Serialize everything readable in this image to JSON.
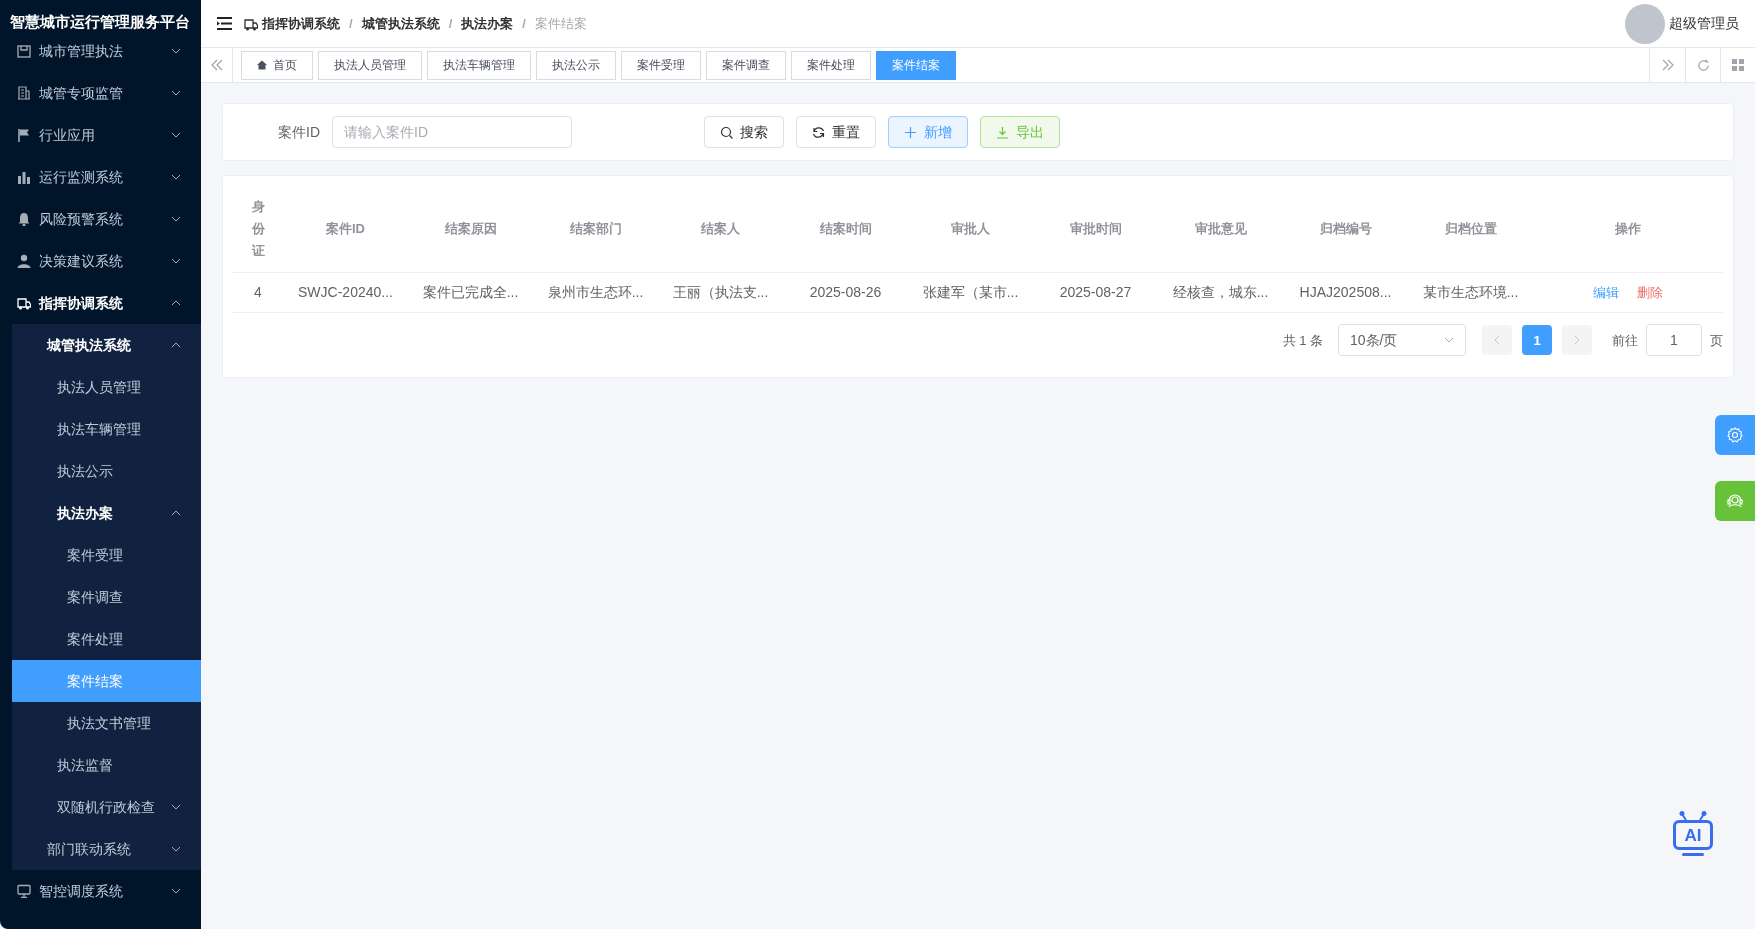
{
  "app_title": "智慧城市运行管理服务平台",
  "sidebar": {
    "items": [
      {
        "label": "城市管理执法",
        "expanded": false,
        "selected": false
      },
      {
        "label": "城管专项监管",
        "expanded": false,
        "selected": false
      },
      {
        "label": "行业应用",
        "expanded": false,
        "selected": false
      },
      {
        "label": "运行监测系统",
        "expanded": false,
        "selected": false
      },
      {
        "label": "风险预警系统",
        "expanded": false,
        "selected": false
      },
      {
        "label": "决策建议系统",
        "expanded": false,
        "selected": false
      },
      {
        "label": "指挥协调系统",
        "expanded": true,
        "selected": false,
        "children": [
          {
            "label": "城管执法系统",
            "expanded": true,
            "selected": false,
            "children": [
              {
                "label": "执法人员管理",
                "selected": false
              },
              {
                "label": "执法车辆管理",
                "selected": false
              },
              {
                "label": "执法公示",
                "selected": false
              },
              {
                "label": "执法办案",
                "expanded": true,
                "selected": false,
                "children": [
                  {
                    "label": "案件受理",
                    "selected": false
                  },
                  {
                    "label": "案件调查",
                    "selected": false
                  },
                  {
                    "label": "案件处理",
                    "selected": false
                  },
                  {
                    "label": "案件结案",
                    "selected": true
                  },
                  {
                    "label": "执法文书管理",
                    "selected": false
                  }
                ]
              },
              {
                "label": "执法监督",
                "selected": false
              },
              {
                "label": "双随机行政检查",
                "expanded": false,
                "selected": false
              }
            ]
          },
          {
            "label": "部门联动系统",
            "expanded": false,
            "selected": false
          }
        ]
      },
      {
        "label": "智控调度系统",
        "expanded": false,
        "selected": false
      }
    ]
  },
  "breadcrumb": [
    "指挥协调系统",
    "城管执法系统",
    "执法办案",
    "案件结案"
  ],
  "breadcrumb_separator": "/",
  "user": {
    "name": "超级管理员"
  },
  "tabs": [
    {
      "label": "首页",
      "selected": false
    },
    {
      "label": "执法人员管理",
      "selected": false
    },
    {
      "label": "执法车辆管理",
      "selected": false
    },
    {
      "label": "执法公示",
      "selected": false
    },
    {
      "label": "案件受理",
      "selected": false
    },
    {
      "label": "案件调查",
      "selected": false
    },
    {
      "label": "案件处理",
      "selected": false
    },
    {
      "label": "案件结案",
      "selected": true
    }
  ],
  "search": {
    "label": "案件ID",
    "placeholder": "请输入案件ID",
    "buttons": [
      {
        "label": "搜索",
        "kind": "search"
      },
      {
        "label": "重置",
        "kind": "reset"
      },
      {
        "label": "新增",
        "kind": "add"
      },
      {
        "label": "导出",
        "kind": "export"
      }
    ]
  },
  "table": {
    "columns": [
      "身份证",
      "案件ID",
      "结案原因",
      "结案部门",
      "结案人",
      "结案时间",
      "审批人",
      "审批时间",
      "审批意见",
      "归档编号",
      "归档位置",
      "操作"
    ],
    "rows": [
      {
        "cells": [
          "4",
          "SWJC-20240...",
          "案件已完成全...",
          "泉州市生态环...",
          "王丽（执法支...",
          "2025-08-26",
          "张建军（某市...",
          "2025-08-27",
          "经核查，城东...",
          "HJAJ202508...",
          "某市生态环境..."
        ],
        "actions": [
          "编辑",
          "删除"
        ]
      }
    ]
  },
  "pagination": {
    "total": "共 1 条",
    "page_size": "10条/页",
    "pages": [
      {
        "label": "1",
        "selected": true
      }
    ],
    "goto_label": "前往",
    "goto_value": "1",
    "goto_suffix": "页"
  },
  "ai_button": {
    "label": "AI"
  }
}
